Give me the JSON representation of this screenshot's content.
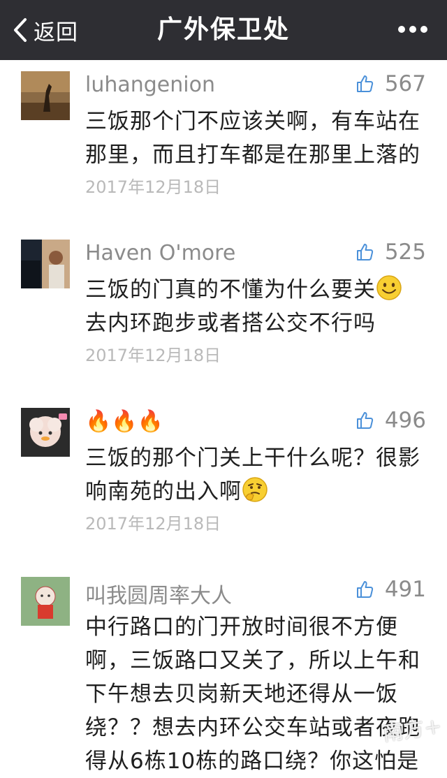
{
  "nav": {
    "back_label": "返回",
    "title": "广外保卫处"
  },
  "comments": [
    {
      "name": "luhangenion",
      "likes": "567",
      "text_line1": "三饭那个门不应该关啊，有车站在",
      "text_line2": "那里，而且打车都是在那里上落的",
      "date": "2017年12月18日"
    },
    {
      "name": "Haven O'more",
      "likes": "525",
      "text_line1": "三饭的门真的不懂为什么要关",
      "text_line2": "去内环跑步或者搭公交不行吗",
      "date": "2017年12月18日"
    },
    {
      "name": "🔥🔥🔥",
      "likes": "496",
      "text_line1": "三饭的那个门关上干什么呢？很影",
      "text_line2": "响南苑的出入啊",
      "date": "2017年12月18日"
    },
    {
      "name": "叫我圆周率大人",
      "likes": "491",
      "text_line1": "中行路口的门开放时间很不方便",
      "text_line2": "啊，三饭路口又关了，所以上午和",
      "text_line3": "下午想去贝岗新天地还得从一饭",
      "text_line4": "绕？？想去内环公交车站或者夜跑",
      "text_line5": "得从6栋10栋的路口绕？你这怕是"
    }
  ],
  "watermark": "南方+",
  "colors": {
    "navbar": "#2e2e33",
    "name": "#8b8b8b",
    "date": "#b9b9b9"
  }
}
